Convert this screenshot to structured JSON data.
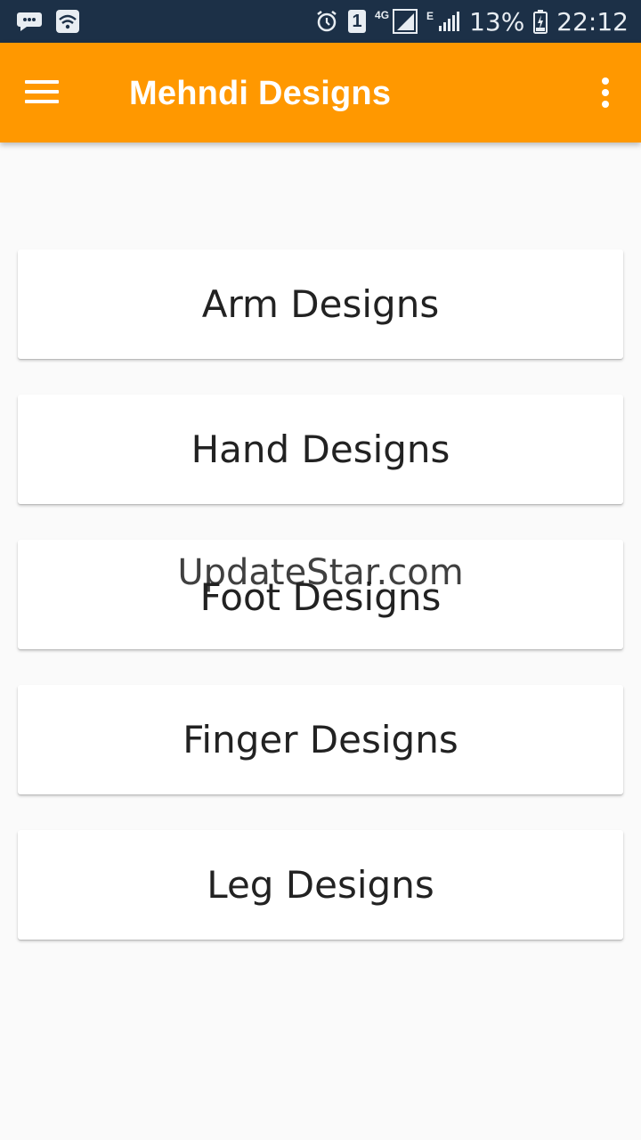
{
  "status_bar": {
    "battery": "13%",
    "time": "22:12",
    "sim_slot": "1",
    "network_primary": "4G",
    "network_secondary": "E",
    "icons": [
      "chat-icon",
      "wifi-icon",
      "alarm-icon",
      "sim-1-icon",
      "signal-4g-icon",
      "signal-e-icon",
      "battery-charging-icon"
    ]
  },
  "app_bar": {
    "title": "Mehndi Designs",
    "background": "#ff9800",
    "left_icon": "hamburger-menu-icon",
    "right_icon": "overflow-menu-icon"
  },
  "categories": [
    {
      "label": "Arm Designs"
    },
    {
      "label": "Hand Designs"
    },
    {
      "label": "Foot Designs"
    },
    {
      "label": "Finger Designs"
    },
    {
      "label": "Leg Designs"
    }
  ],
  "watermark": "UpdateStar.com"
}
